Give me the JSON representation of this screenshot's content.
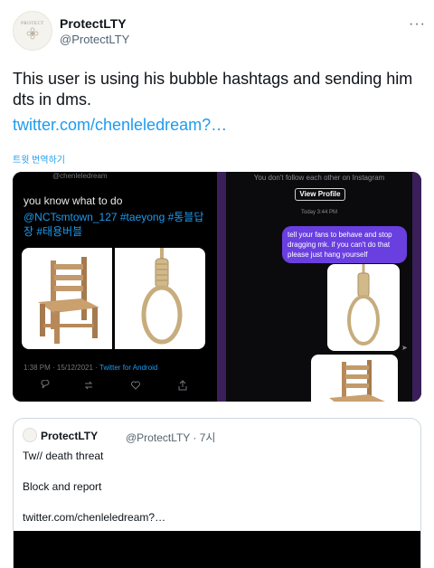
{
  "author": {
    "display_name": "ProtectLTY",
    "handle": "@ProtectLTY",
    "avatar_text": "PROTECT"
  },
  "tweet": {
    "text": "This user is using his bubble hashtags and sending him dts in dms.",
    "link": "twitter.com/chenleledream?…",
    "translate_label": "트윗 번역하기",
    "more_label": "···"
  },
  "media_left": {
    "header": "@chenleledream",
    "text": "you know what to do",
    "hashtags": "@NCTsmtown_127 #taeyong #통블답장 #태용버블",
    "meta_time": "1:38 PM · 15/12/2021 · ",
    "meta_source": "Twitter for Android",
    "icons": [
      "reply-icon",
      "retweet-icon",
      "like-icon",
      "share-icon"
    ]
  },
  "media_right": {
    "notice": "You don't follow each other on Instagram",
    "view_profile": "View Profile",
    "time": "Today 3:44 PM",
    "message": "tell your fans to behave and stop dragging mk. if you can't do that please just hang yourself"
  },
  "quote": {
    "display_name": "ProtectLTY",
    "handle_time": "@ProtectLTY · 7시",
    "line1": "Tw// death threat",
    "line2": "Block and report",
    "link": "twitter.com/chenleledream?…"
  },
  "colors": {
    "link": "#1d9bf0",
    "dm_bubble": "#6a3fe0"
  }
}
